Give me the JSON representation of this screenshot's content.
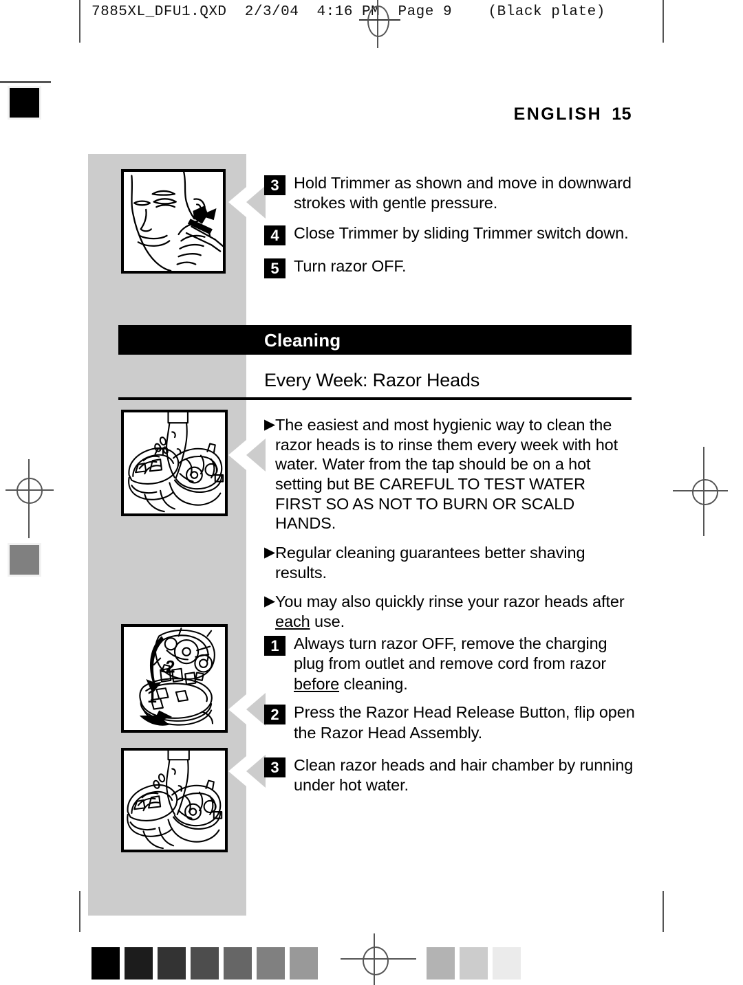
{
  "prepress": {
    "header_line": "7885XL_DFU1.QXD  2/3/04  4:16 PM  Page 9    (Black plate)",
    "registration_marks": [
      "reg-top",
      "reg-left",
      "reg-right",
      "reg-bottom"
    ]
  },
  "header": {
    "language": "ENGLISH",
    "page_number": "15"
  },
  "top_steps": [
    {
      "number": "3",
      "text": "Hold Trimmer as shown and move in downward strokes with gentle pressure."
    },
    {
      "number": "4",
      "text": "Close Trimmer by sliding Trimmer switch down."
    },
    {
      "number": "5",
      "text": "Turn razor OFF."
    }
  ],
  "section": {
    "band_title": "Cleaning",
    "subsection_title": "Every Week: Razor Heads"
  },
  "bullets": [
    {
      "marker": "▶",
      "parts": [
        {
          "text": "The easiest and most hygienic way to clean the razor heads is to rinse them every week with hot water. Water from the tap should be on a hot setting but BE CAREFUL TO TEST WATER FIRST SO AS NOT TO BURN OR SCALD HANDS.",
          "underline": false
        }
      ]
    },
    {
      "marker": "▶",
      "parts": [
        {
          "text": "Regular cleaning guarantees better shaving results.",
          "underline": false
        }
      ]
    },
    {
      "marker": "▶",
      "parts": [
        {
          "text": "You may also quickly rinse your razor heads after ",
          "underline": false
        },
        {
          "text": "each",
          "underline": true
        },
        {
          "text": " use.",
          "underline": false
        }
      ]
    }
  ],
  "bottom_steps": [
    {
      "number": "1",
      "parts": [
        {
          "text": "Always turn razor OFF, remove the charging plug from outlet and remove cord from razor ",
          "underline": false
        },
        {
          "text": "before",
          "underline": true
        },
        {
          "text": " cleaning.",
          "underline": false
        }
      ]
    },
    {
      "number": "2",
      "parts": [
        {
          "text": "Press the Razor Head Release Button, flip open the Razor Head Assembly.",
          "underline": false
        }
      ]
    },
    {
      "number": "3",
      "parts": [
        {
          "text": "Clean razor heads and hair chamber by running under hot water.",
          "underline": false
        }
      ]
    }
  ],
  "illustrations": [
    {
      "name": "trimmer-on-sideburn-illustration",
      "caption_labels": []
    },
    {
      "name": "rinsing-razor-heads-illustration",
      "caption_labels": []
    },
    {
      "name": "flip-open-razor-head-assembly-illustration",
      "caption_labels": [
        "1",
        "2"
      ]
    },
    {
      "name": "rinsing-razor-heads-under-tap-illustration",
      "caption_labels": []
    }
  ],
  "color_strip": {
    "swatches_left": [
      "#000000",
      "#1c1c1c",
      "#333333",
      "#4d4d4d",
      "#666666",
      "#808080",
      "#999999"
    ],
    "swatches_right": [
      "#b3b3b3",
      "#cccccc",
      "#ebebeb"
    ]
  },
  "colors": {
    "ink_black": "#000000",
    "sidebar_gray": "#cccccc",
    "paper_white": "#ffffff",
    "rule_gray": "#555555"
  }
}
